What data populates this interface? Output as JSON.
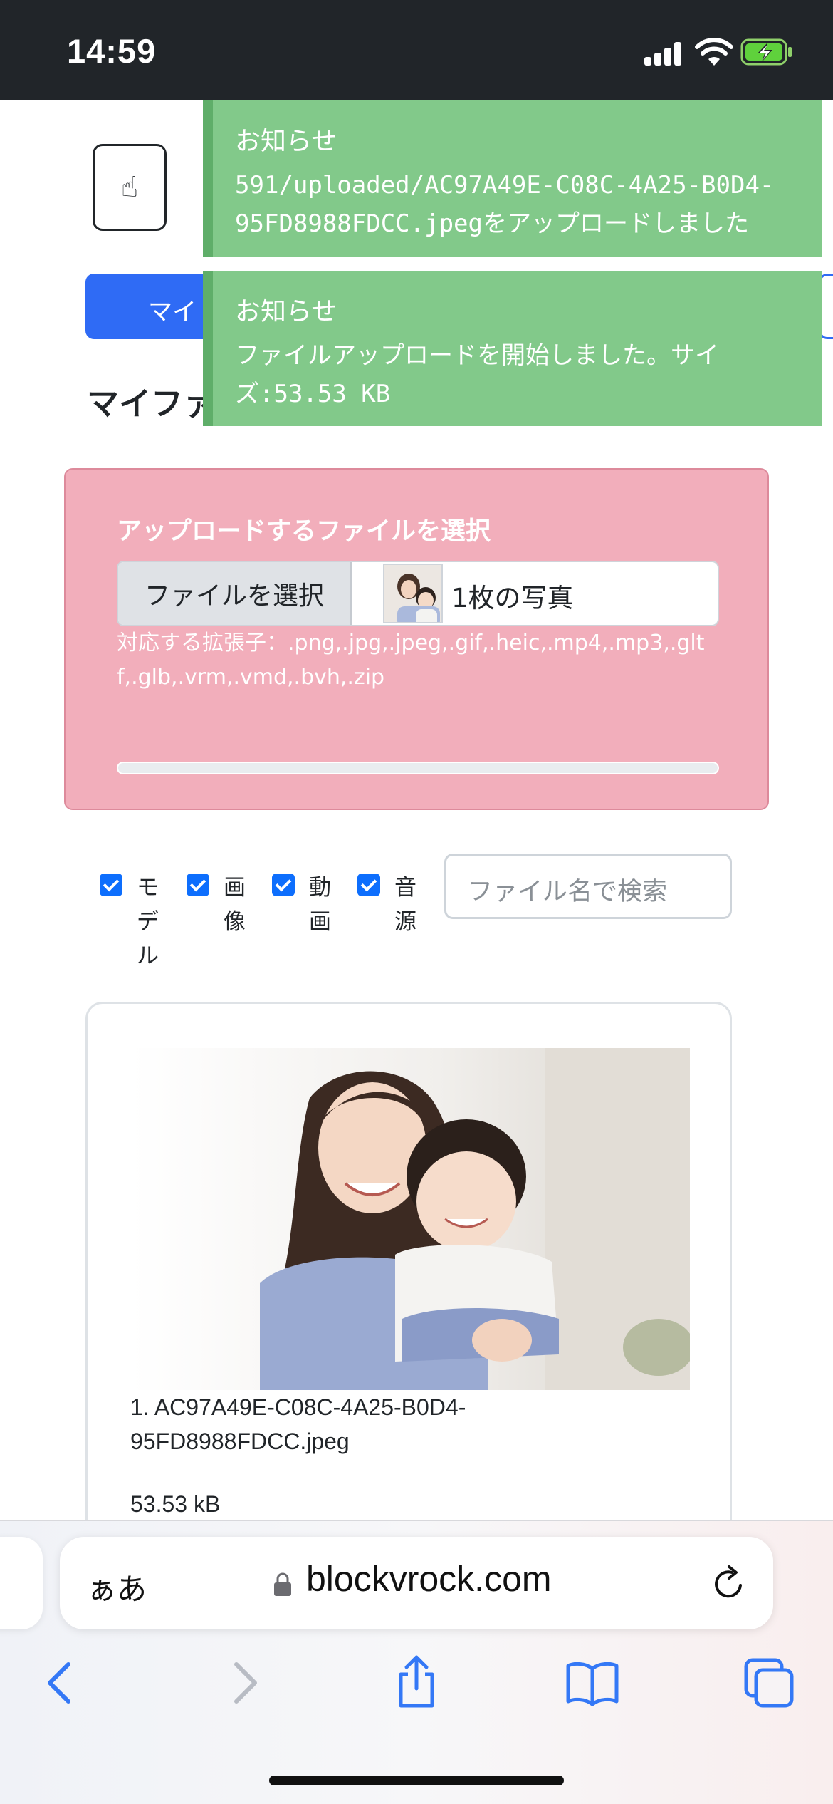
{
  "status_bar": {
    "time": "14:59"
  },
  "header": {
    "logo_icon": "hand-pointer-icon",
    "active_tab_label": "マイ",
    "page_title": "マイファ"
  },
  "toasts": [
    {
      "title": "お知らせ",
      "message": "591/uploaded/AC97A49E-C08C-4A25-B0D4-95FD8988FDCC.jpegをアップロードしました"
    },
    {
      "title": "お知らせ",
      "message": "ファイルアップロードを開始しました。サイズ:53.53 KB"
    }
  ],
  "upload": {
    "heading": "アップロードするファイルを選択",
    "choose_button": "ファイルを選択",
    "selected_status": "1枚の写真",
    "extensions_text": "対応する拡張子：.png,.jpg,.jpeg,.gif,.heic,.mp4,.mp3,.gltf,.glb,.vrm,.vmd,.bvh,.zip",
    "progress": 0
  },
  "filters": [
    {
      "label": "モデル",
      "checked": true
    },
    {
      "label": "画像",
      "checked": true
    },
    {
      "label": "動画",
      "checked": true
    },
    {
      "label": "音源",
      "checked": true
    }
  ],
  "search": {
    "placeholder": "ファイル名で検索"
  },
  "file_card": {
    "name": "1. AC97A49E-C08C-4A25-B0D4-95FD8988FDCC.jpeg",
    "size": "53.53 kB"
  },
  "browser": {
    "text_size_label": "ぁあ",
    "domain": "blockvrock.com"
  },
  "colors": {
    "accent": "#2f6bf5",
    "toast": "#82c98a",
    "upload_panel": "#f2aebb",
    "status_bar": "#212529"
  }
}
